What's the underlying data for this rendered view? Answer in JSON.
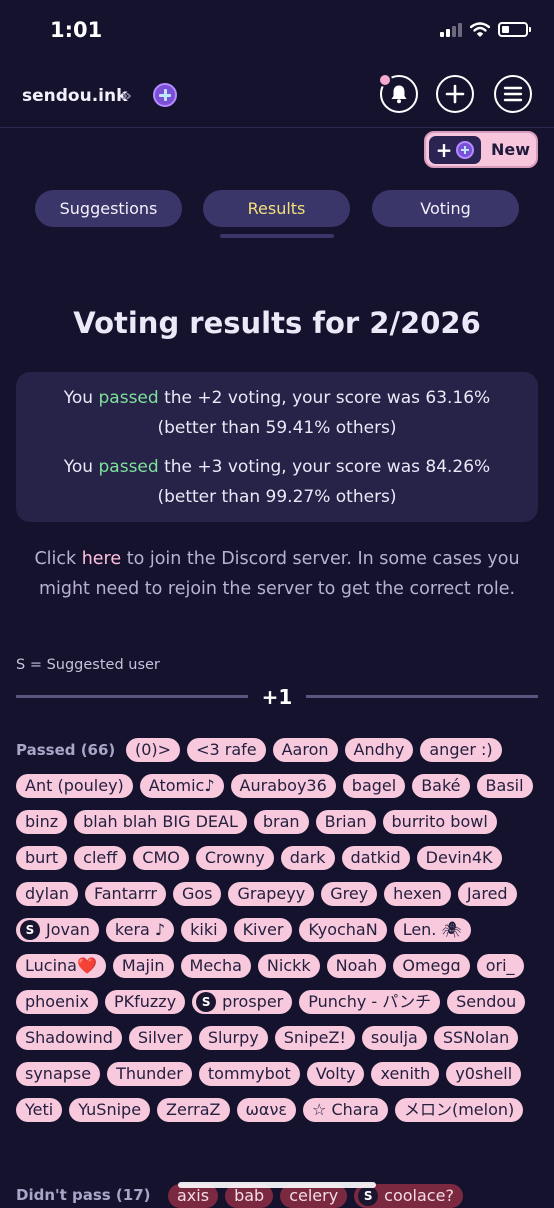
{
  "status_bar": {
    "time": "1:01"
  },
  "nav": {
    "logo_text": "sendou.ink",
    "chevron": "»"
  },
  "new_button": {
    "plus": "+",
    "label": "New"
  },
  "tabs": [
    {
      "label": "Suggestions",
      "active": false
    },
    {
      "label": "Results",
      "active": true
    },
    {
      "label": "Voting",
      "active": false
    }
  ],
  "page_title": "Voting results for 2/2026",
  "results": [
    {
      "prefix": "You ",
      "status": "passed",
      "line1_rest": " the +2 voting, your score was 63.16%",
      "line2": "(better than 59.41% others)"
    },
    {
      "prefix": "You ",
      "status": "passed",
      "line1_rest": " the +3 voting, your score was 84.26%",
      "line2": "(better than 99.27% others)"
    }
  ],
  "discord": {
    "before": "Click ",
    "link": "here",
    "after": " to join the Discord server. In some cases you might need to rejoin the server to get the correct role."
  },
  "legend": "S = Suggested user",
  "tier_label": "+1",
  "passed": {
    "label": "Passed (66)",
    "users": [
      {
        "name": "(0)>",
        "s": false
      },
      {
        "name": "<3 rafe",
        "s": false
      },
      {
        "name": "Aaron",
        "s": false
      },
      {
        "name": "Andhy",
        "s": false
      },
      {
        "name": "anger :)",
        "s": false
      },
      {
        "name": "Ant (pouley)",
        "s": false
      },
      {
        "name": "Atomic♪",
        "s": false
      },
      {
        "name": "Auraboy36",
        "s": false
      },
      {
        "name": "bagel",
        "s": false
      },
      {
        "name": "Baké",
        "s": false
      },
      {
        "name": "Basil",
        "s": false
      },
      {
        "name": "binz",
        "s": false
      },
      {
        "name": "blah blah BIG DEAL",
        "s": false
      },
      {
        "name": "bran",
        "s": false
      },
      {
        "name": "Brian",
        "s": false
      },
      {
        "name": "burrito bowl",
        "s": false
      },
      {
        "name": "burt",
        "s": false
      },
      {
        "name": "cleff",
        "s": false
      },
      {
        "name": "CMO",
        "s": false
      },
      {
        "name": "Crowny",
        "s": false
      },
      {
        "name": "dark",
        "s": false
      },
      {
        "name": "datkid",
        "s": false
      },
      {
        "name": "Devin4K",
        "s": false
      },
      {
        "name": "dylan",
        "s": false
      },
      {
        "name": "Fantarrr",
        "s": false
      },
      {
        "name": "Gos",
        "s": false
      },
      {
        "name": "Grapeyy",
        "s": false
      },
      {
        "name": "Grey",
        "s": false
      },
      {
        "name": "hexen",
        "s": false
      },
      {
        "name": "Jared",
        "s": false
      },
      {
        "name": "Jovan",
        "s": true
      },
      {
        "name": "kera ♪",
        "s": false
      },
      {
        "name": "kiki",
        "s": false
      },
      {
        "name": "Kiver",
        "s": false
      },
      {
        "name": "KyochaN",
        "s": false
      },
      {
        "name": "Len. 🕷",
        "s": false
      },
      {
        "name": "Lucina❤️",
        "s": false
      },
      {
        "name": "Majin",
        "s": false
      },
      {
        "name": "Mecha",
        "s": false
      },
      {
        "name": "Nickk",
        "s": false
      },
      {
        "name": "Noah",
        "s": false
      },
      {
        "name": "Omegɑ",
        "s": false
      },
      {
        "name": "ori_",
        "s": false
      },
      {
        "name": "phoenix",
        "s": false
      },
      {
        "name": "PKfuzzy",
        "s": false
      },
      {
        "name": "prosper",
        "s": true
      },
      {
        "name": "Punchy - パンチ",
        "s": false
      },
      {
        "name": "Sendou",
        "s": false
      },
      {
        "name": "Shadowind",
        "s": false
      },
      {
        "name": "Silver",
        "s": false
      },
      {
        "name": "Slurpy",
        "s": false
      },
      {
        "name": "SnipeZ!",
        "s": false
      },
      {
        "name": "soulja",
        "s": false
      },
      {
        "name": "SSNolan",
        "s": false
      },
      {
        "name": "synapse",
        "s": false
      },
      {
        "name": "Thunder",
        "s": false
      },
      {
        "name": "tommybot",
        "s": false
      },
      {
        "name": "Volty",
        "s": false
      },
      {
        "name": "xenith",
        "s": false
      },
      {
        "name": "y0shell",
        "s": false
      },
      {
        "name": "Yeti",
        "s": false
      },
      {
        "name": "YuSnipe",
        "s": false
      },
      {
        "name": "ZerraZ",
        "s": false
      },
      {
        "name": "ωανε",
        "s": false
      },
      {
        "name": "☆ Chara",
        "s": false
      },
      {
        "name": "メロン(melon)",
        "s": false
      }
    ]
  },
  "failed": {
    "label": "Didn't pass (17)",
    "users": [
      {
        "name": "axis",
        "s": false
      },
      {
        "name": "bab",
        "s": false
      },
      {
        "name": "celery",
        "s": false
      },
      {
        "name": "coolace?",
        "s": true
      }
    ]
  },
  "suggested_badge": "S",
  "colors": {
    "background": "#15122e",
    "accent_pink": "#f8c9dd",
    "passed_green": "#7fe19b",
    "active_tab": "#f4e07a",
    "fail_chip": "#7b2940"
  },
  "icons": [
    "bell-icon",
    "plus-icon",
    "menu-icon",
    "plus-badge-icon"
  ]
}
